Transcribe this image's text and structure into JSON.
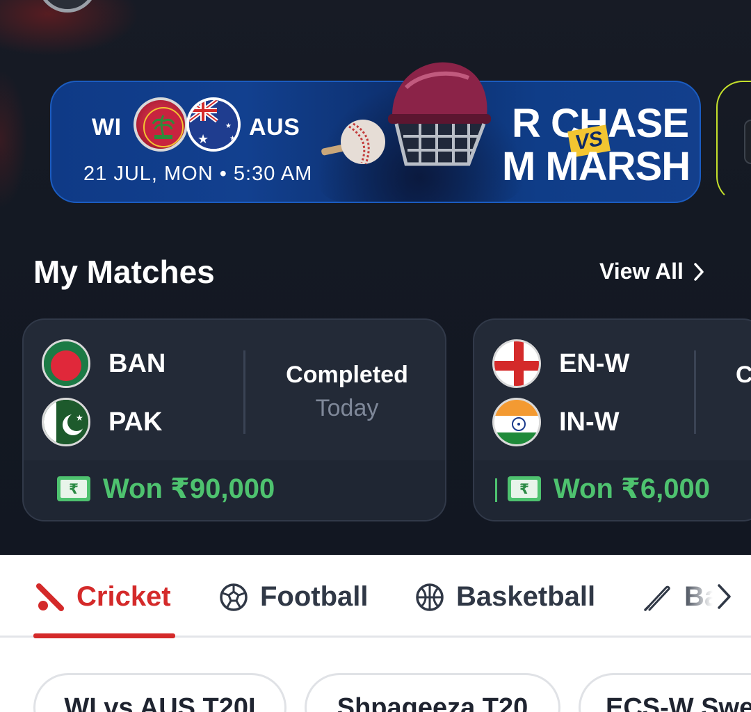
{
  "banner": {
    "team1": "WI",
    "team2": "AUS",
    "datetime": "21 JUL, MON • 5:30 AM",
    "player1": "R CHASE",
    "vs": "VS",
    "player2": "M MARSH"
  },
  "my_matches": {
    "title": "My Matches",
    "view_all": "View All",
    "cards": [
      {
        "team1": "BAN",
        "team2": "PAK",
        "status": "Completed",
        "status_sub": "Today",
        "winnings": "Won ₹90,000"
      },
      {
        "team1": "EN-W",
        "team2": "IN-W",
        "status": "C",
        "winnings": "Won ₹6,000"
      }
    ]
  },
  "sports_tabs": [
    {
      "label": "Cricket",
      "icon": "cricket-bat-icon",
      "active": true
    },
    {
      "label": "Football",
      "icon": "football-icon",
      "active": false
    },
    {
      "label": "Basketball",
      "icon": "basketball-icon",
      "active": false
    },
    {
      "label": "Ba",
      "icon": "baseball-bat-icon",
      "active": false
    }
  ],
  "tournament_pills": [
    {
      "label": "WI vs AUS T20I"
    },
    {
      "label": "Shpageeza T20"
    },
    {
      "label": "ECS-W Swe"
    }
  ],
  "colors": {
    "accent_red": "#d42a2a",
    "won_green": "#4ec26f",
    "banner_blue": "#0f3a86",
    "vs_yellow": "#f3c531"
  }
}
